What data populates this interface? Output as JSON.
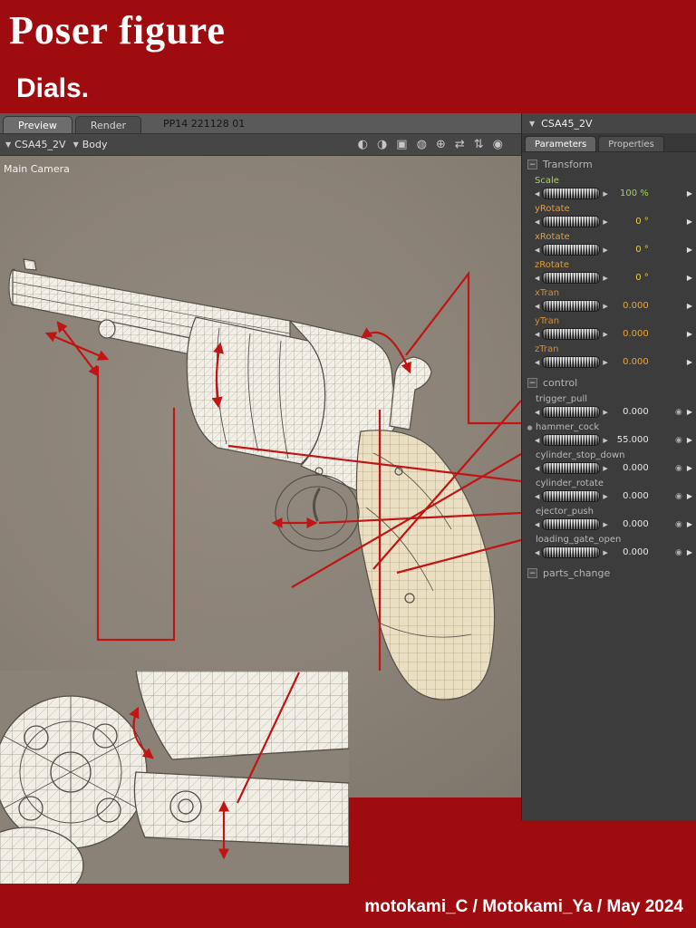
{
  "banner": {
    "title": "Poser figure",
    "subtitle": "Dials."
  },
  "viewport": {
    "tabs": [
      {
        "label": "Preview"
      },
      {
        "label": "Render"
      }
    ],
    "document_title": "PP14 221128 01",
    "figure_selector": "CSA45_2V",
    "actor_selector": "Body",
    "camera_label": "Main Camera",
    "icons": [
      {
        "name": "face-camera-left-icon",
        "glyph": "◐"
      },
      {
        "name": "face-camera-right-icon",
        "glyph": "◑"
      },
      {
        "name": "select-keyframe-icon",
        "glyph": "▣"
      },
      {
        "name": "trackball-icon",
        "glyph": "◍"
      },
      {
        "name": "rotate-icon",
        "glyph": "⊕"
      },
      {
        "name": "translate-icon",
        "glyph": "⇄"
      },
      {
        "name": "elevate-icon",
        "glyph": "⇅"
      },
      {
        "name": "grab-icon",
        "glyph": "◉"
      }
    ]
  },
  "panel": {
    "title": "CSA45_2V",
    "tabs": [
      {
        "label": "Parameters"
      },
      {
        "label": "Properties"
      }
    ],
    "sections": {
      "transform": "Transform",
      "control": "control",
      "parts": "parts_change"
    },
    "transform": {
      "dials": [
        {
          "label": "Scale",
          "value": "100 %",
          "label_color": "#a8d44e",
          "value_color": "#a8d44e"
        },
        {
          "label": "yRotate",
          "value": "0 °",
          "label_color": "#e09d3d",
          "value_color": "#e3cf4e"
        },
        {
          "label": "xRotate",
          "value": "0 °",
          "label_color": "#e09d3d",
          "value_color": "#e3cf4e"
        },
        {
          "label": "zRotate",
          "value": "0 °",
          "label_color": "#e09d3d",
          "value_color": "#e3cf4e"
        },
        {
          "label": "xTran",
          "value": "0.000",
          "label_color": "#d78e2e",
          "value_color": "#dfa93e"
        },
        {
          "label": "yTran",
          "value": "0.000",
          "label_color": "#d78e2e",
          "value_color": "#dfa93e"
        },
        {
          "label": "zTran",
          "value": "0.000",
          "label_color": "#d78e2e",
          "value_color": "#dfa93e"
        }
      ]
    },
    "control": {
      "dials": [
        {
          "label": "trigger_pull",
          "value": "0.000",
          "marker": "",
          "label_color": "#b9b9b9",
          "value_color": "#e8e8e8"
        },
        {
          "label": "hammer_cock",
          "value": "55.000",
          "marker": "●",
          "label_color": "#b9b9b9",
          "value_color": "#e8e8e8"
        },
        {
          "label": "cylinder_stop_down",
          "value": "0.000",
          "marker": "",
          "label_color": "#b9b9b9",
          "value_color": "#e8e8e8"
        },
        {
          "label": "cylinder_rotate",
          "value": "0.000",
          "marker": "",
          "label_color": "#b9b9b9",
          "value_color": "#e8e8e8"
        },
        {
          "label": "ejector_push",
          "value": "0.000",
          "marker": "",
          "label_color": "#b9b9b9",
          "value_color": "#e8e8e8"
        },
        {
          "label": "loading_gate_open",
          "value": "0.000",
          "marker": "",
          "label_color": "#b9b9b9",
          "value_color": "#e8e8e8"
        }
      ]
    }
  },
  "icons": {
    "dropdown": "▼",
    "collapse": "−",
    "left": "◀",
    "right": "▶",
    "eye": "◉"
  },
  "colors": {
    "banner_red": "#9e0c10",
    "annotation_red": "#c11414",
    "viewport_grey": "#8b8277",
    "panel_grey": "#3c3c3c"
  },
  "footer": {
    "credit": "motokami_C / Motokami_Ya / May 2024"
  }
}
